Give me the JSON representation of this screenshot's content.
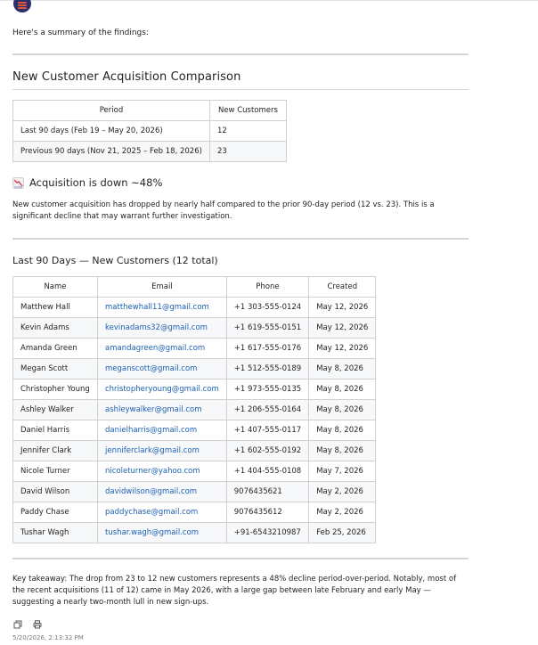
{
  "intro": "Here's a summary of the findings:",
  "comparison": {
    "title": "New Customer Acquisition Comparison",
    "headers": [
      "Period",
      "New Customers"
    ],
    "rows": [
      [
        "Last 90 days (Feb 19 – May 20, 2026)",
        "12"
      ],
      [
        "Previous 90 days (Nov 21, 2025 – Feb 18, 2026)",
        "23"
      ]
    ]
  },
  "trend": {
    "icon": "chart-decreasing-icon",
    "heading": "Acquisition is down ~48%",
    "body": "New customer acquisition has dropped by nearly half compared to the prior 90-day period (12 vs. 23). This is a significant decline that may warrant further investigation."
  },
  "customers": {
    "title": "Last 90 Days — New Customers (12 total)",
    "headers": [
      "Name",
      "Email",
      "Phone",
      "Created"
    ],
    "rows": [
      [
        "Matthew Hall",
        "matthewhall11@gmail.com",
        "+1 303-555-0124",
        "May 12, 2026"
      ],
      [
        "Kevin Adams",
        "kevinadams32@gmail.com",
        "+1 619-555-0151",
        "May 12, 2026"
      ],
      [
        "Amanda Green",
        "amandagreen@gmail.com",
        "+1 617-555-0176",
        "May 12, 2026"
      ],
      [
        "Megan Scott",
        "meganscott@gmail.com",
        "+1 512-555-0189",
        "May 8, 2026"
      ],
      [
        "Christopher Young",
        "christopheryoung@gmail.com",
        "+1 973-555-0135",
        "May 8, 2026"
      ],
      [
        "Ashley Walker",
        "ashleywalker@gmail.com",
        "+1 206-555-0164",
        "May 8, 2026"
      ],
      [
        "Daniel Harris",
        "danielharris@gmail.com",
        "+1 407-555-0117",
        "May 8, 2026"
      ],
      [
        "Jennifer Clark",
        "jenniferclark@gmail.com",
        "+1 602-555-0192",
        "May 8, 2026"
      ],
      [
        "Nicole Turner",
        "nicoleturner@yahoo.com",
        "+1 404-555-0108",
        "May 7, 2026"
      ],
      [
        "David Wilson",
        "davidwilson@gmail.com",
        "9076435621",
        "May 2, 2026"
      ],
      [
        "Paddy Chase",
        "paddychase@gmail.com",
        "9076435612",
        "May 2, 2026"
      ],
      [
        "Tushar Wagh",
        "tushar.wagh@gmail.com",
        "+91-6543210987",
        "Feb 25, 2026"
      ]
    ]
  },
  "takeaway": "Key takeaway: The drop from 23 to 12 new customers represents a 48% decline period-over-period. Notably, most of the recent acquisitions (11 of 12) came in May 2026, with a large gap between late February and early May — suggesting a nearly two-month lull in new sign-ups.",
  "actions": {
    "copy_icon": "copy-icon",
    "print_icon": "print-icon"
  },
  "timestamp": "5/20/2026, 2:13:32 PM",
  "colors": {
    "link": "#1a5fb4",
    "avatar": "#2b2f6b",
    "avatar_accent": "#e0533c"
  }
}
